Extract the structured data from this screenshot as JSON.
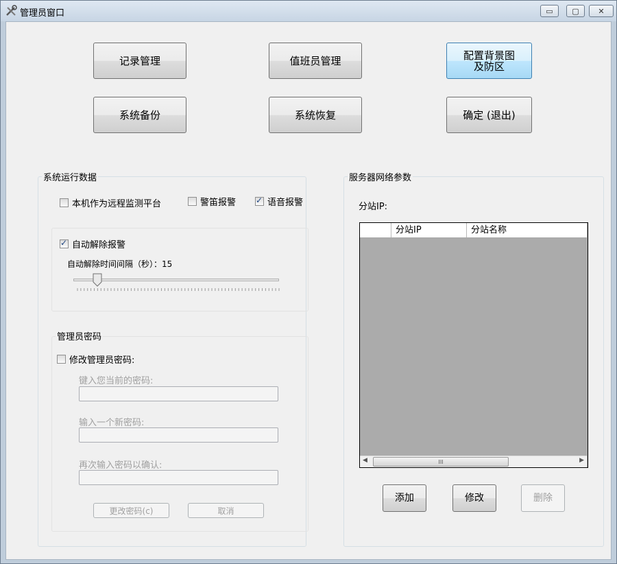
{
  "window": {
    "title": "管理员窗口",
    "controls": {
      "minimize": "▭",
      "maximize": "▢",
      "close": "✕"
    }
  },
  "top_buttons": {
    "record_mgmt": "记录管理",
    "duty_mgmt": "值班员管理",
    "config_bg": "配置背景图\n及防区",
    "backup": "系统备份",
    "restore": "系统恢复",
    "confirm_exit": "确定 (退出)"
  },
  "runtime": {
    "group_title": "系统运行数据",
    "remote_platform": {
      "label": "本机作为远程监测平台",
      "checked": false
    },
    "siren_alarm": {
      "label": "警笛报警",
      "checked": false
    },
    "voice_alarm": {
      "label": "语音报警",
      "checked": true
    },
    "auto_clear": {
      "label": "自动解除报警",
      "checked": true
    },
    "interval_label": "自动解除时间间隔（秒）：15",
    "slider_value": 15
  },
  "password": {
    "group_title": "管理员密码",
    "modify": {
      "label": "修改管理员密码:",
      "checked": false
    },
    "current_label": "键入您当前的密码:",
    "new_label": "输入一个新密码:",
    "confirm_label": "再次输入密码以确认:",
    "current_value": "",
    "new_value": "",
    "confirm_value": "",
    "change_button": "更改密码(c)",
    "cancel_button": "取消"
  },
  "server": {
    "group_title": "服务器网络参数",
    "substation_label": "分站IP:",
    "columns": [
      "",
      "分站IP",
      "分站名称"
    ],
    "scroll_grip": "III",
    "add_button": "添加",
    "edit_button": "修改",
    "delete_button": "删除"
  }
}
